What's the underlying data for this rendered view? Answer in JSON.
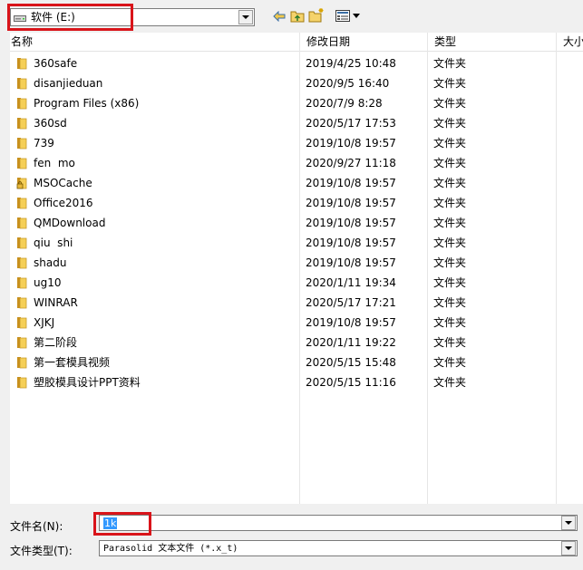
{
  "toolbar": {
    "look_in_value": "软件 (E:)",
    "icons": [
      "back-arrow-icon",
      "up-folder-icon",
      "new-folder-icon",
      "view-menu-icon"
    ]
  },
  "columns": {
    "name": "名称",
    "date": "修改日期",
    "type": "类型",
    "size": "大小"
  },
  "files": [
    {
      "name": "360safe",
      "date": "2019/4/25 10:48",
      "type": "文件夹",
      "icon": "folder-icon"
    },
    {
      "name": "disanjieduan",
      "date": "2020/9/5 16:40",
      "type": "文件夹",
      "icon": "folder-icon"
    },
    {
      "name": "Program Files (x86)",
      "date": "2020/7/9 8:28",
      "type": "文件夹",
      "icon": "folder-icon"
    },
    {
      "name": "360sd",
      "date": "2020/5/17 17:53",
      "type": "文件夹",
      "icon": "folder-icon"
    },
    {
      "name": "739",
      "date": "2019/10/8 19:57",
      "type": "文件夹",
      "icon": "folder-icon"
    },
    {
      "name": "fen  mo",
      "date": "2020/9/27 11:18",
      "type": "文件夹",
      "icon": "folder-icon"
    },
    {
      "name": "MSOCache",
      "date": "2019/10/8 19:57",
      "type": "文件夹",
      "icon": "locked-folder-icon"
    },
    {
      "name": "Office2016",
      "date": "2019/10/8 19:57",
      "type": "文件夹",
      "icon": "folder-icon"
    },
    {
      "name": "QMDownload",
      "date": "2019/10/8 19:57",
      "type": "文件夹",
      "icon": "folder-icon"
    },
    {
      "name": "qiu  shi",
      "date": "2019/10/8 19:57",
      "type": "文件夹",
      "icon": "folder-icon"
    },
    {
      "name": "shadu",
      "date": "2019/10/8 19:57",
      "type": "文件夹",
      "icon": "folder-icon"
    },
    {
      "name": "ug10",
      "date": "2020/1/11 19:34",
      "type": "文件夹",
      "icon": "folder-icon"
    },
    {
      "name": "WINRAR",
      "date": "2020/5/17 17:21",
      "type": "文件夹",
      "icon": "folder-icon"
    },
    {
      "name": "XJKJ",
      "date": "2019/10/8 19:57",
      "type": "文件夹",
      "icon": "folder-icon"
    },
    {
      "name": "第二阶段",
      "date": "2020/1/11 19:22",
      "type": "文件夹",
      "icon": "folder-icon"
    },
    {
      "name": "第一套模具视频",
      "date": "2020/5/15 15:48",
      "type": "文件夹",
      "icon": "folder-icon"
    },
    {
      "name": "塑胶模具设计PPT资料",
      "date": "2020/5/15 11:16",
      "type": "文件夹",
      "icon": "folder-icon"
    }
  ],
  "filename_field": {
    "label": "文件名(N):",
    "value": "1k"
  },
  "filetype_field": {
    "label": "文件类型(T):",
    "value": "Parasolid 文本文件 (*.x_t)"
  },
  "colors": {
    "highlight_red": "#d9141a",
    "selection_blue": "#3399ff",
    "folder_yellow": "#e8b83a"
  }
}
